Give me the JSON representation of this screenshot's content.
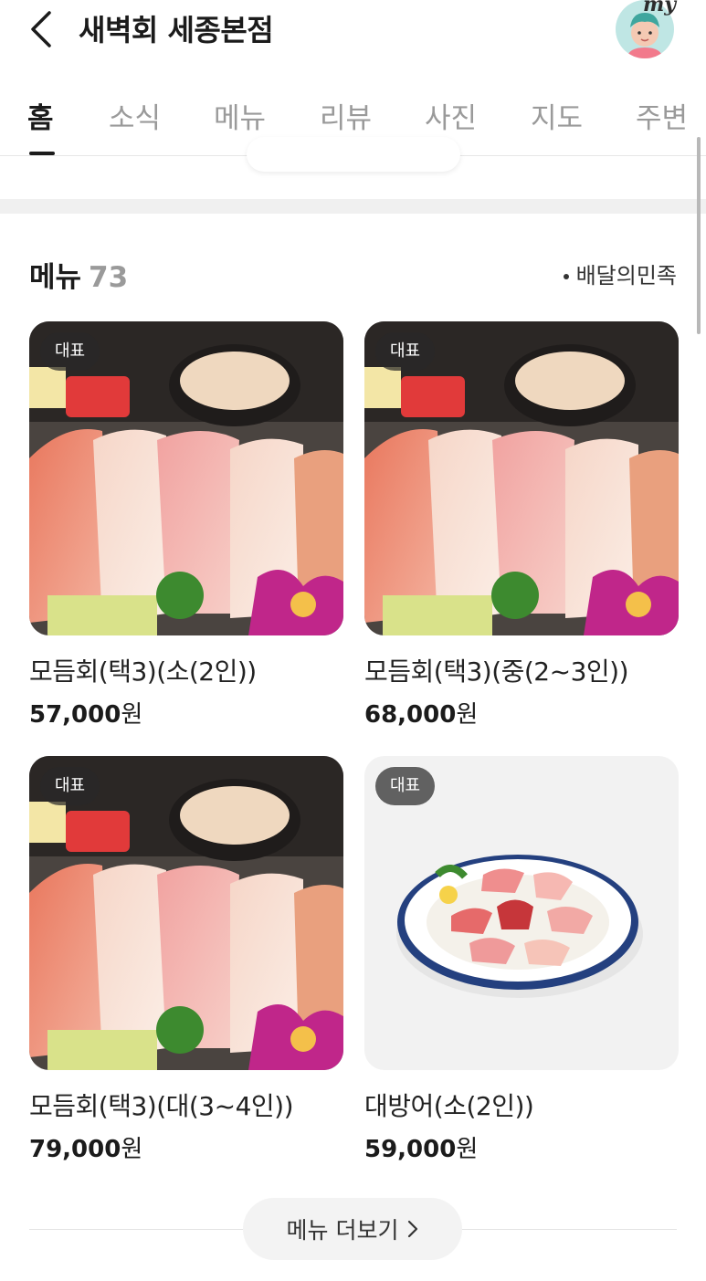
{
  "header": {
    "title": "새벽회 세종본점",
    "avatar_label": "my"
  },
  "tabs": [
    {
      "label": "홈",
      "active": true
    },
    {
      "label": "소식"
    },
    {
      "label": "메뉴"
    },
    {
      "label": "리뷰"
    },
    {
      "label": "사진"
    },
    {
      "label": "지도"
    },
    {
      "label": "주변"
    }
  ],
  "menu_section": {
    "title": "메뉴",
    "count": "73",
    "source": "배달의민족"
  },
  "menu_items": [
    {
      "badge": "대표",
      "name": "모듬회(택3)(소(2인))",
      "price": "57,000",
      "currency": "원",
      "image": "sashimi-platter"
    },
    {
      "badge": "대표",
      "name": "모듬회(택3)(중(2~3인))",
      "price": "68,000",
      "currency": "원",
      "image": "sashimi-platter"
    },
    {
      "badge": "대표",
      "name": "모듬회(택3)(대(3~4인))",
      "price": "79,000",
      "currency": "원",
      "image": "sashimi-platter"
    },
    {
      "badge": "대표",
      "name": "대방어(소(2인))",
      "price": "59,000",
      "currency": "원",
      "image": "yellowtail-plate"
    }
  ],
  "more_button": {
    "label": "메뉴 더보기"
  },
  "colors": {
    "accent_text": "#1b1b1b",
    "muted": "#9a9a9a",
    "badge_bg": "#282828"
  }
}
